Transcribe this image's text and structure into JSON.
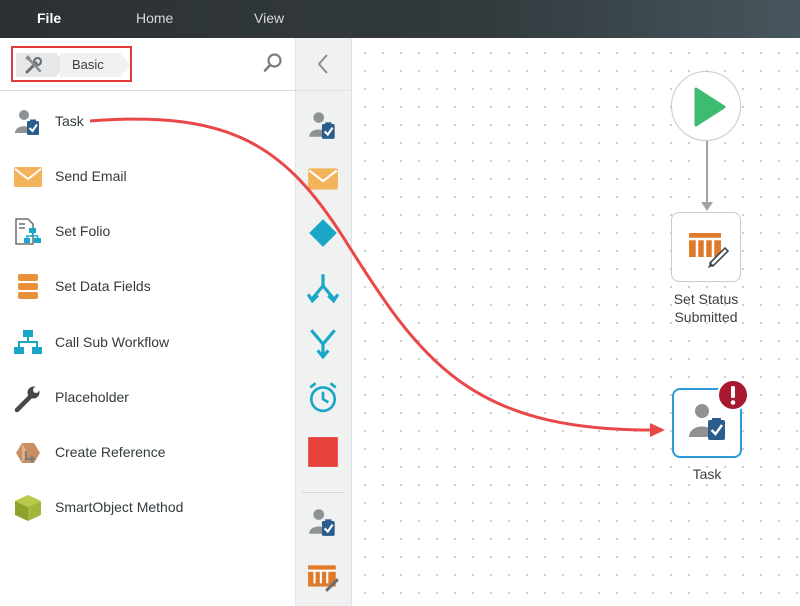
{
  "menu": {
    "items": [
      {
        "label": "File",
        "active": true
      },
      {
        "label": "Home",
        "active": false
      },
      {
        "label": "View",
        "active": false
      }
    ]
  },
  "toolbox": {
    "breadcrumb": {
      "root_icon": "tools-icon",
      "current": "Basic"
    },
    "search_icon": "search-icon",
    "items": [
      {
        "label": "Task",
        "icon": "task-user-icon"
      },
      {
        "label": "Send Email",
        "icon": "envelope-icon"
      },
      {
        "label": "Set Folio",
        "icon": "folio-icon"
      },
      {
        "label": "Set Data Fields",
        "icon": "data-fields-icon"
      },
      {
        "label": "Call Sub Workflow",
        "icon": "sub-workflow-icon"
      },
      {
        "label": "Placeholder",
        "icon": "wrench-icon"
      },
      {
        "label": "Create Reference",
        "icon": "reference-icon"
      },
      {
        "label": "SmartObject Method",
        "icon": "smartobject-icon"
      }
    ]
  },
  "strip": {
    "collapse_icon": "chevron-left-icon",
    "icons": [
      "task-user-icon",
      "envelope-icon",
      "decision-icon",
      "split-icon",
      "merge-icon",
      "timer-icon",
      "stop-icon",
      "task-user-icon",
      "set-status-icon"
    ]
  },
  "canvas": {
    "start_icon": "play-icon",
    "status_node": {
      "label_line1": "Set Status",
      "label_line2": "Submitted",
      "icon": "set-status-icon"
    },
    "task_node": {
      "label": "Task",
      "icon": "task-user-icon",
      "error": "!"
    }
  },
  "colors": {
    "menubar": "#2c3133",
    "highlight": "#e23c3c",
    "start": "#3dbb70",
    "orange": "#e07a2b",
    "teal": "#1aa7c7",
    "stop": "#e9413b",
    "task_border": "#2b9ad6",
    "error": "#a6192e"
  }
}
